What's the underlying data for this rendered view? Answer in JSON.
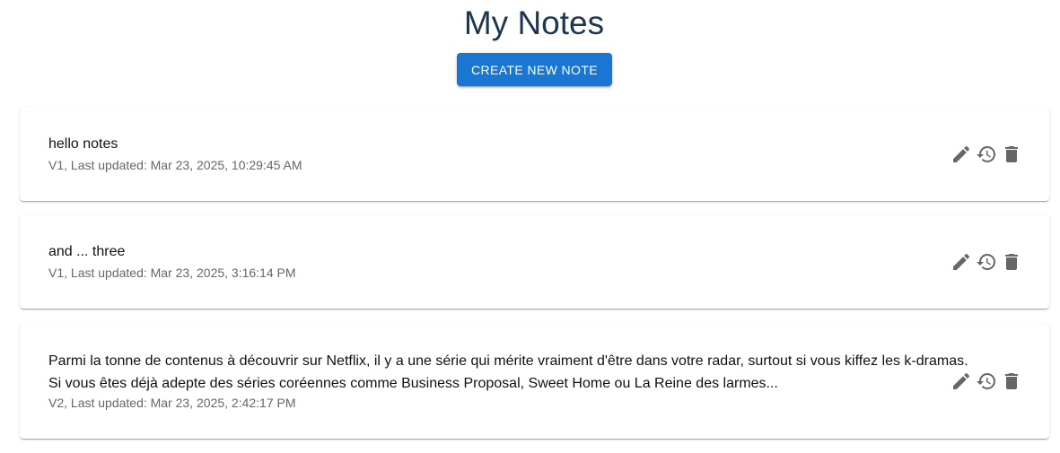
{
  "header": {
    "title": "My Notes",
    "create_button_label": "CREATE NEW NOTE"
  },
  "notes": [
    {
      "text": "hello notes",
      "meta": "V1, Last updated: Mar 23, 2025, 10:29:45 AM"
    },
    {
      "text": "and ... three",
      "meta": "V1, Last updated: Mar 23, 2025, 3:16:14 PM"
    },
    {
      "text": "Parmi la tonne de contenus à découvrir sur Netflix, il y a une série qui mérite vraiment d'être dans votre radar, surtout si vous kiffez les k-dramas.\nSi vous êtes déjà adepte des séries coréennes comme Business Proposal, Sweet Home ou La Reine des larmes...",
      "meta": "V2, Last updated: Mar 23, 2025, 2:42:17 PM"
    }
  ],
  "icons": {
    "edit": "edit-icon",
    "history": "history-icon",
    "delete": "delete-icon",
    "icon_color": "#666666"
  },
  "colors": {
    "title": "#1e3650",
    "accent": "#1976d2"
  }
}
